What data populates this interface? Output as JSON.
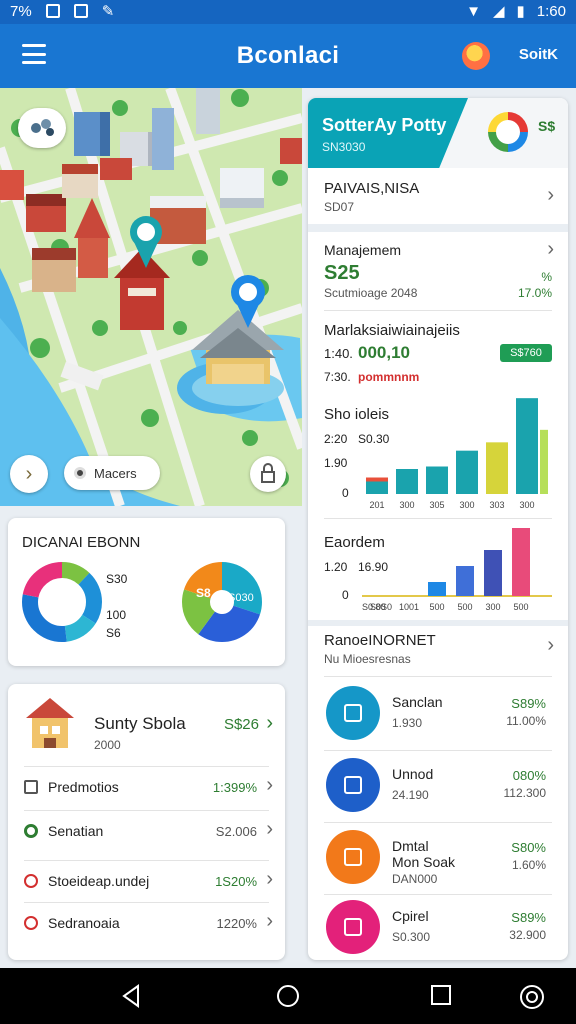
{
  "status": {
    "left": [
      "7%"
    ],
    "right": [
      "1:60"
    ]
  },
  "appbar": {
    "title": "Bconlaci",
    "action": "SoitK"
  },
  "map": {
    "search_label": "Macers"
  },
  "panel": {
    "header": {
      "title": "SotterAy Potty",
      "subtitle": "SN3030",
      "price": "S$"
    },
    "link1": {
      "title": "PAIVAIS,NISA",
      "sub": "SD07"
    },
    "management": {
      "title": "Manajemem",
      "value": "S25",
      "pct_top": "%",
      "sub": "Scutmioage 2048",
      "pct": "17.0%"
    },
    "market": {
      "title": "Marlaksiaiwiainajeiis",
      "row1_label": "1:40.",
      "row1_value": "000,10",
      "badge": "S$760",
      "row2_label": "7:30.",
      "row2_value": "pommnnm"
    },
    "bar_chart_1": {
      "title": "Sho ioleis",
      "labels": [
        "2:20",
        "S0.30",
        "1.90",
        "0"
      ],
      "categories": [
        "201",
        "300",
        "305",
        "300",
        "303",
        "300"
      ],
      "values": [
        15,
        30,
        33,
        52,
        62,
        115
      ],
      "secondary": [
        8,
        0,
        0,
        0,
        0,
        77
      ],
      "colors": [
        "#1aa3ad",
        "#1aa3ad",
        "#1aa3ad",
        "#1aa3ad",
        "#d6d43a",
        "#1aa3ad"
      ]
    },
    "bar_chart_2": {
      "title": "Eaordem",
      "labels": [
        "1.20",
        "16.90",
        "0",
        "S0.80"
      ],
      "categories": [
        "S0S0",
        "1001",
        "500",
        "500",
        "300",
        "500"
      ],
      "values": [
        0,
        0,
        14,
        30,
        46,
        68
      ],
      "colors": [
        "#1e88e5",
        "#1e88e5",
        "#1e88e5",
        "#3f6fd8",
        "#3f51b5",
        "#e84b7a"
      ]
    },
    "ranked": {
      "title": "RanoeINORNET",
      "sub": "Nu Mioesresnas"
    },
    "items": [
      {
        "name": "Sanclan",
        "sub": "1.930",
        "pct": "S89%",
        "pct_sub": "11.00%",
        "color": "#1597c8"
      },
      {
        "name": "Unnod",
        "sub": "24.190",
        "pct": "080%",
        "pct_sub": "112.300",
        "color": "#1e5fc9"
      },
      {
        "name": "Dmtal",
        "name2": "Mon Soak",
        "sub": "DAN000",
        "pct": "S80%",
        "pct_sub": "1.60%",
        "color": "#f2791a"
      },
      {
        "name": "Cpirel",
        "sub": "S0.300",
        "pct": "S89%",
        "pct_sub": "32.900",
        "color": "#e3217a"
      }
    ]
  },
  "donut_card": {
    "title": "DICANAI EBONN",
    "labels": [
      "S30",
      "100",
      "S6"
    ],
    "donut1": [
      {
        "value": 12,
        "color": "#7cc242"
      },
      {
        "value": 22,
        "color": "#1e90d8"
      },
      {
        "value": 14,
        "color": "#2db6d3"
      },
      {
        "value": 30,
        "color": "#1976d2"
      },
      {
        "value": 22,
        "color": "#e8307b"
      }
    ],
    "donut2": [
      {
        "value": 30,
        "color": "#1aa9c7"
      },
      {
        "value": 30,
        "color": "#2a5fd8"
      },
      {
        "value": 20,
        "color": "#7cc242"
      },
      {
        "value": 20,
        "color": "#f2891a"
      }
    ],
    "donut2_labels": [
      "S8",
      "S030"
    ]
  },
  "list_card": {
    "feature": {
      "title": "Sunty Sbola",
      "sub": "2000",
      "value": "S$26"
    },
    "rows": [
      {
        "label": "Predmotios",
        "value": "1:399%",
        "icon": "square-icon",
        "color": "#2e7d32"
      },
      {
        "label": "Senatian",
        "value": "S2.006",
        "icon": "green-circle-icon",
        "color": "#555"
      },
      {
        "label": "Stoeideap.undej",
        "value": "1S20%",
        "icon": "pin-icon",
        "color": "#2e7d32"
      },
      {
        "label": "Sedranoaia",
        "value": "1220%",
        "icon": "pin-icon",
        "color": "#555"
      }
    ]
  }
}
